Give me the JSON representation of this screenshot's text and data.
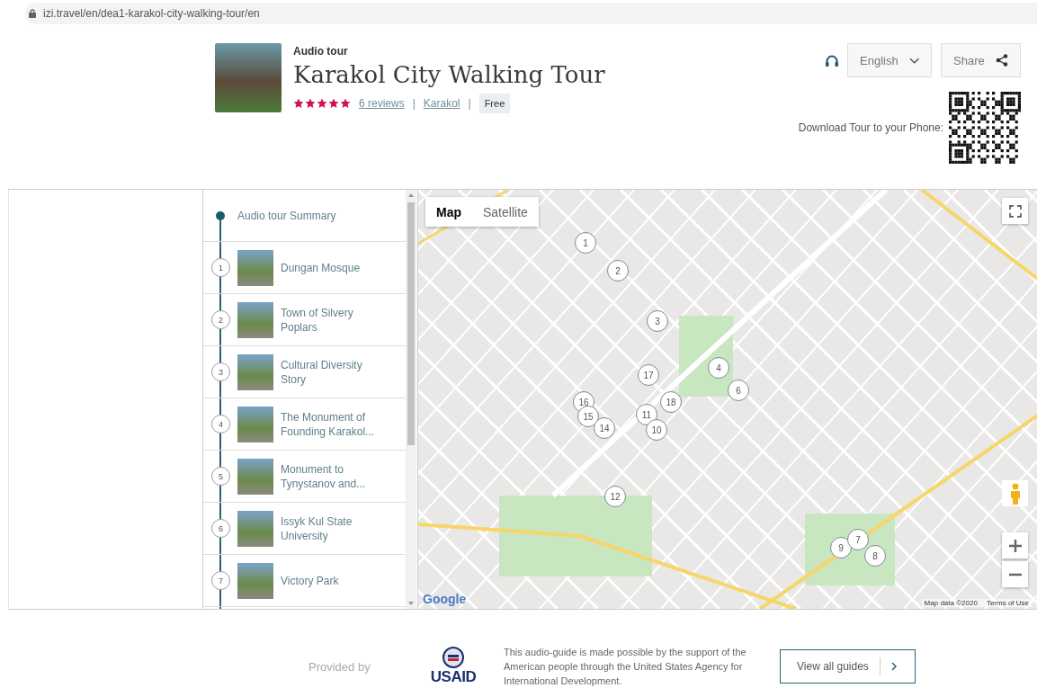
{
  "address_bar": {
    "url": "izi.travel/en/dea1-karakol-city-walking-tour/en"
  },
  "tour": {
    "type": "Audio tour",
    "title": "Karakol City Walking Tour",
    "stars": 5,
    "reviews_link": "6 reviews",
    "separators": [
      "|",
      "|"
    ],
    "city_link": "Karakol",
    "price": "Free",
    "language_button": "English",
    "share_button": "Share",
    "download_label": "Download Tour to your Phone:"
  },
  "stops": {
    "summary": "Audio tour Summary",
    "items": [
      {
        "number": "1",
        "title": "Dungan Mosque"
      },
      {
        "number": "2",
        "title": "Town of Silvery Poplars"
      },
      {
        "number": "3",
        "title": "Cultural Diversity Story"
      },
      {
        "number": "4",
        "title": "The Monument of Founding Karakol..."
      },
      {
        "number": "5",
        "title": "Monument to Tynystanov and..."
      },
      {
        "number": "6",
        "title": "Issyk Kul State University"
      },
      {
        "number": "7",
        "title": "Victory Park"
      }
    ]
  },
  "map": {
    "tabs": [
      {
        "label": "Map",
        "selected": true
      },
      {
        "label": "Satellite",
        "selected": false
      }
    ],
    "markers": [
      "1",
      "2",
      "3",
      "4",
      "6",
      "17",
      "18",
      "16",
      "15",
      "14",
      "11",
      "10",
      "12",
      "9",
      "7",
      "8"
    ],
    "logo": "Google",
    "attribution": "Map data ©2020",
    "terms_link": "Terms of Use"
  },
  "footer": {
    "provided_by": "Provided by",
    "logo_text": "USAID",
    "sponsor_note": "This audio-guide is made possible by the support of the American people through the United States Agency for International Development.",
    "view_all_button": "View all guides"
  }
}
